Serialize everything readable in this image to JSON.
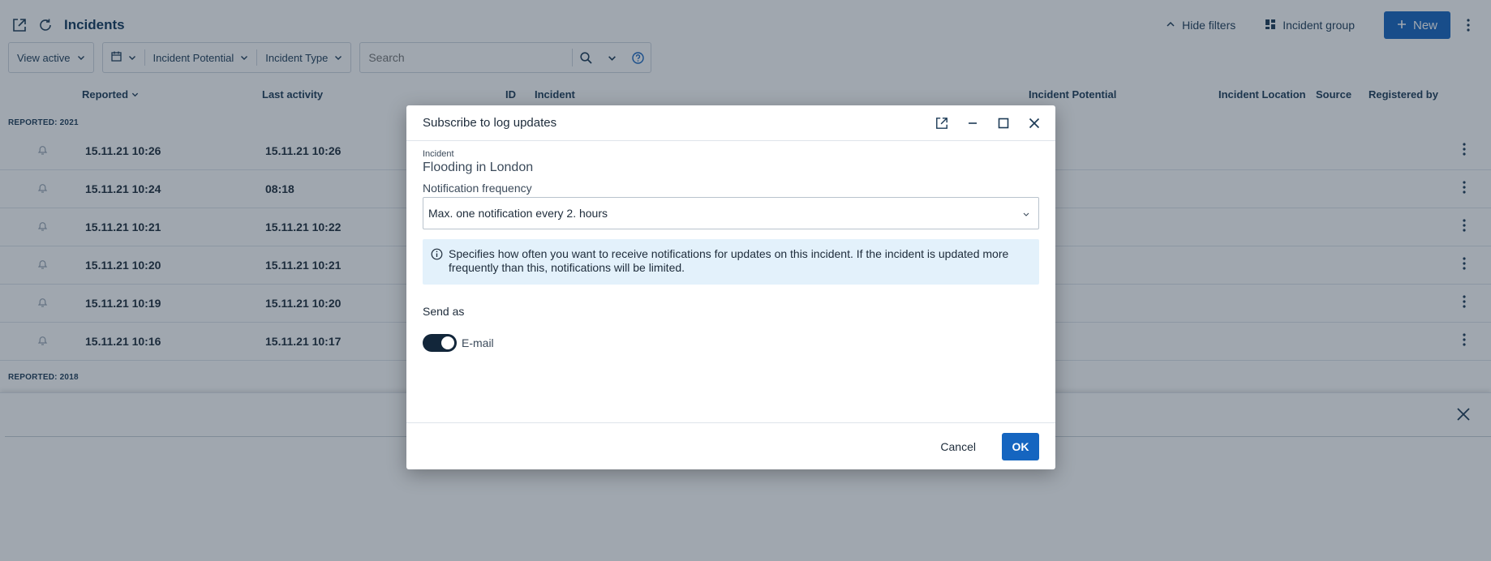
{
  "header": {
    "title": "Incidents",
    "hide_filters_label": "Hide filters",
    "incident_group_label": "Incident group",
    "new_label": "New"
  },
  "filters": {
    "view_label": "View active",
    "potential_label": "Incident Potential",
    "type_label": "Incident Type",
    "search_placeholder": "Search"
  },
  "table": {
    "columns": {
      "reported": "Reported",
      "last_activity": "Last activity",
      "id": "ID",
      "incident": "Incident",
      "potential": "Incident Potential",
      "location": "Incident Location",
      "source": "Source",
      "registered_by": "Registered by"
    },
    "groups": [
      "REPORTED: 2021",
      "REPORTED: 2018"
    ],
    "rows": [
      {
        "reported": "15.11.21 10:26",
        "last_activity": "15.11.21 10:26"
      },
      {
        "reported": "15.11.21 10:24",
        "last_activity": "08:18"
      },
      {
        "reported": "15.11.21 10:21",
        "last_activity": "15.11.21 10:22"
      },
      {
        "reported": "15.11.21 10:20",
        "last_activity": "15.11.21 10:21"
      },
      {
        "reported": "15.11.21 10:19",
        "last_activity": "15.11.21 10:20"
      },
      {
        "reported": "15.11.21 10:16",
        "last_activity": "15.11.21 10:17"
      }
    ]
  },
  "modal": {
    "title": "Subscribe to log updates",
    "incident_label": "Incident",
    "incident_value": "Flooding in London",
    "frequency_label": "Notification frequency",
    "frequency_value": "Max. one notification every 2. hours",
    "info_text": "Specifies how often you want to receive notifications for updates on this incident. If the incident is updated more frequently than this, notifications will be limited.",
    "send_as_label": "Send as",
    "email_label": "E-mail",
    "email_enabled": true,
    "cancel_label": "Cancel",
    "ok_label": "OK"
  },
  "colors": {
    "primary": "#1565c0",
    "overlay": "#1c2d40",
    "info_bg": "#e3f1fb",
    "toggle_on": "#12263a"
  },
  "icons": [
    "open-external-icon",
    "refresh-icon",
    "chevron-up-icon",
    "grid-icon",
    "plus-icon",
    "kebab-icon",
    "calendar-icon",
    "chevron-down-icon",
    "search-icon",
    "help-icon",
    "bell-icon",
    "minimize-icon",
    "maximize-icon",
    "close-icon",
    "info-icon"
  ]
}
